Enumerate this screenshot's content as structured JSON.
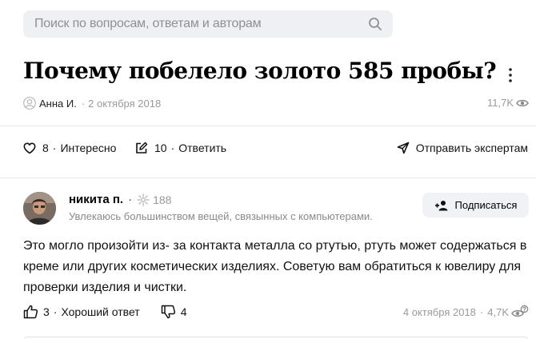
{
  "search": {
    "placeholder": "Поиск по вопросам, ответам и авторам"
  },
  "question": {
    "title": "Почему побелело золото 585 пробы?",
    "author": "Анна И.",
    "date": "2 октября 2018",
    "views": "11,7K"
  },
  "actions": {
    "likes_count": "8",
    "likes_label": "Интересно",
    "answers_count": "10",
    "answers_label": "Ответить",
    "send_label": "Отправить экспертам"
  },
  "answer": {
    "author_name": "никита п.",
    "score": "188",
    "description": "Увлекаюсь большинством вещей, связынных с компьютерами.",
    "subscribe_label": "Подписаться",
    "text": "Это могло произойти из- за контакта металла со ртутью, ртуть может содержаться в креме или других косметических изделиях. Советую вам обратиться к ювелиру для проверки изделия и чистки.",
    "likes_count": "3",
    "likes_label": "Хороший ответ",
    "dislikes_count": "4",
    "date": "4 октября 2018",
    "views": "4,7K"
  },
  "separator": "·"
}
